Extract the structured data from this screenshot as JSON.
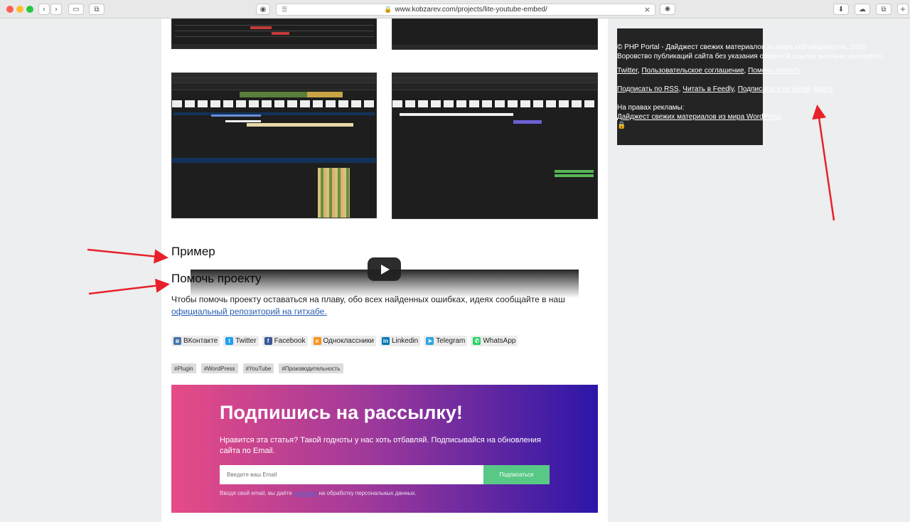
{
  "browser": {
    "url": "www.kobzarev.com/projects/lite-youtube-embed/",
    "back": "‹",
    "forward": "›"
  },
  "page": {
    "example_heading": "Пример",
    "help_heading": "Помочь проекту",
    "help_text": "Чтобы помочь проекту оставаться на плаву, обо всех найденных ошибках, идеях сообщайте в наш ",
    "help_link": "официальный репозиторий на гитхабе.",
    "shares": [
      {
        "label": "ВКонтакте",
        "icon": "vk-icon",
        "color": "#4a76a8",
        "glyph": "в"
      },
      {
        "label": "Twitter",
        "icon": "twitter-icon",
        "color": "#1da1f2",
        "glyph": "t"
      },
      {
        "label": "Facebook",
        "icon": "facebook-icon",
        "color": "#3b5998",
        "glyph": "f"
      },
      {
        "label": "Одноклассники",
        "icon": "odnoklassniki-icon",
        "color": "#f7931e",
        "glyph": "о"
      },
      {
        "label": "Linkedin",
        "icon": "linkedin-icon",
        "color": "#0077b5",
        "glyph": "in"
      },
      {
        "label": "Telegram",
        "icon": "telegram-icon",
        "color": "#2ca5e0",
        "glyph": "➤"
      },
      {
        "label": "WhatsApp",
        "icon": "whatsapp-icon",
        "color": "#25d366",
        "glyph": "✆"
      }
    ],
    "tags": [
      "#Plugin",
      "#WordPress",
      "#YouTube",
      "#Производительность"
    ],
    "subscribe": {
      "title": "Подпишись на рассылку!",
      "text": "Нравится эта статья? Такой годноты у нас хоть отбавляй. Подписывайся на обновления сайта по Email.",
      "placeholder": "Введите ваш Email",
      "button": "Подписаться",
      "note_prefix": "Вводя свой email, вы даёте ",
      "note_link": "согласие",
      "note_suffix": " на обработку персональных данных."
    }
  },
  "footer": {
    "copyright": "© PHP Portal - Дайджест свежих материалов из мира веб-разработки, 2020",
    "warning": "Воровство публикаций сайта без указания обратной ссылки анально наказуемо.",
    "links1": [
      "Twitter",
      "Пользовательское соглашение",
      "Помочь проекту"
    ],
    "links2": [
      "Подписать по RSS",
      "Читать в Feedly",
      "Подписаться по Email",
      "Карта"
    ],
    "ad_label": "На правах рекламы:",
    "ad_link": "Дайджест свежих материалов из мира WordPress"
  },
  "colors": {
    "arrow": "#e8202a",
    "subscribe_button": "#58c887"
  }
}
